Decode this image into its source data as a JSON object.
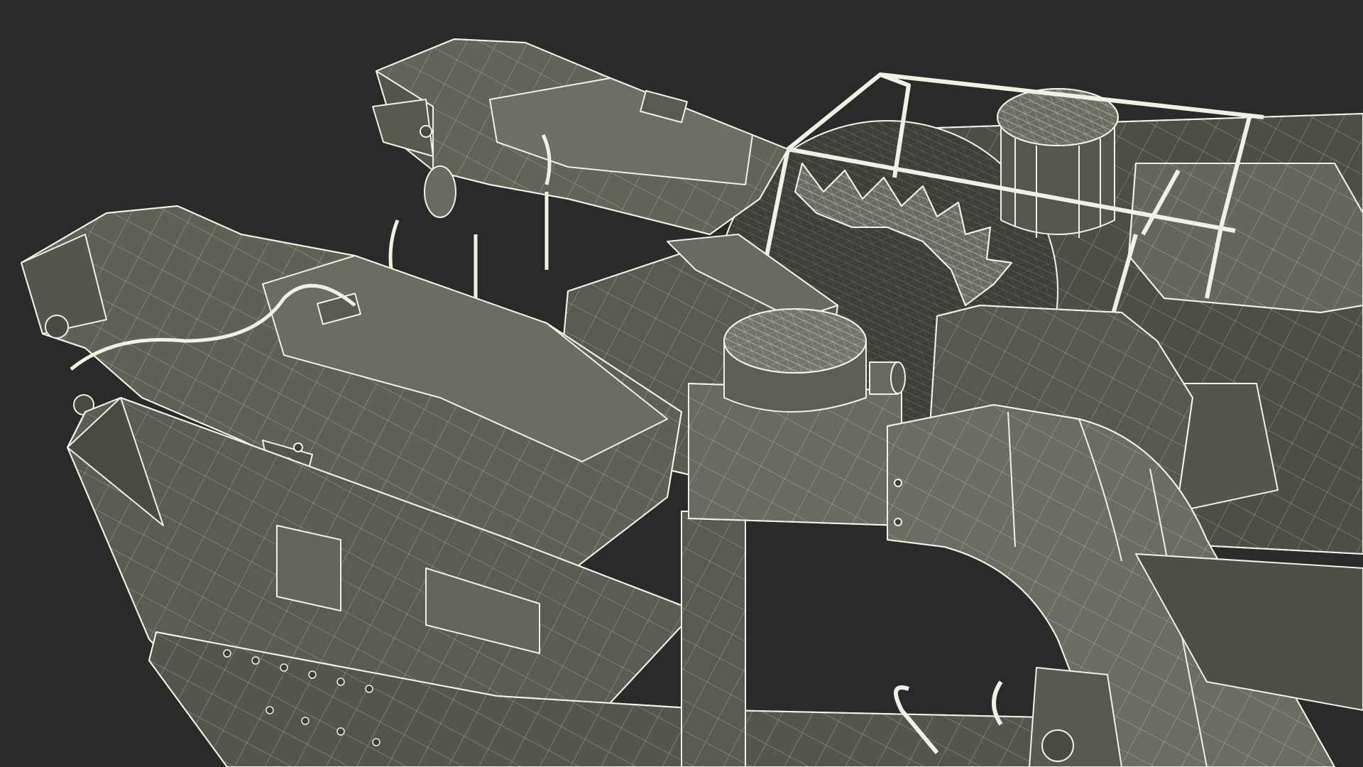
{
  "scene": {
    "subject": "wireframe-machinery-render",
    "background_color": "#2a2a2a",
    "surface_color": "#5e5e55",
    "surface_light_color": "#75756b",
    "surface_dark_color": "#4a4a43",
    "wire_color": "#f1f0e4"
  }
}
